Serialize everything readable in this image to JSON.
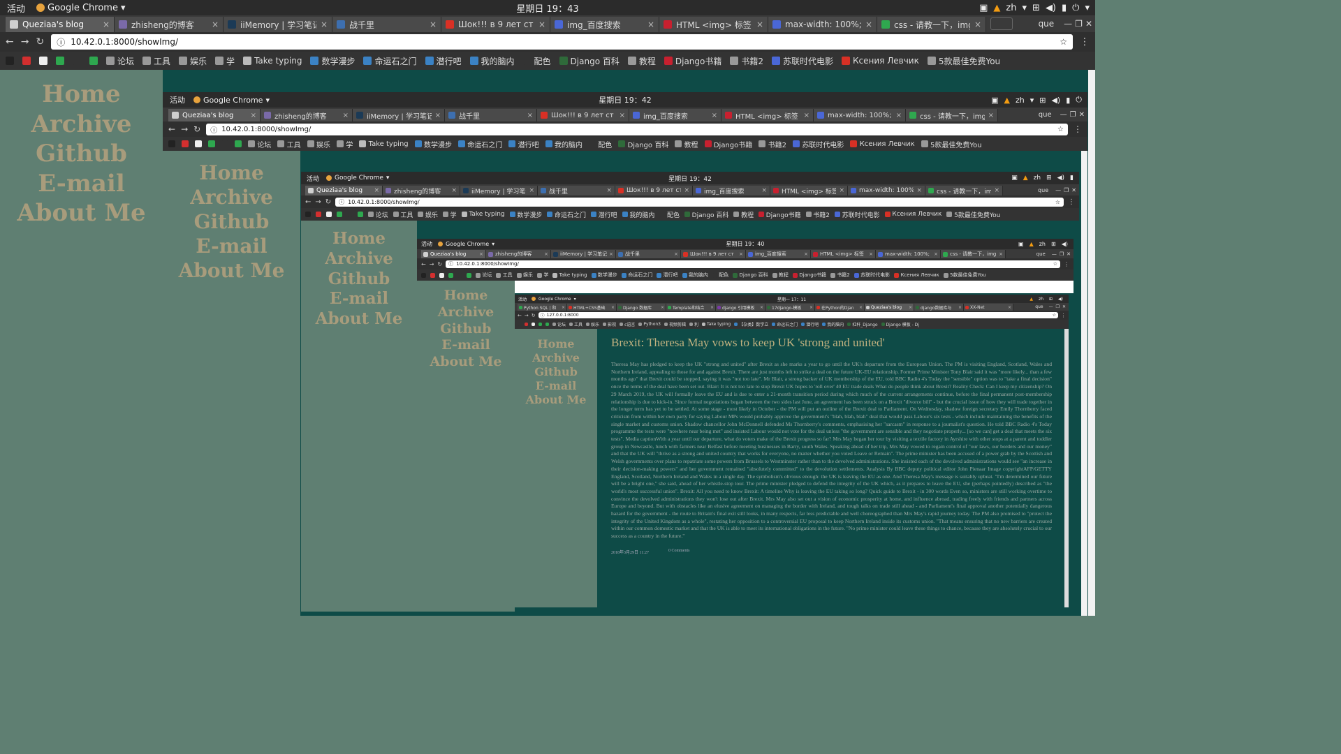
{
  "top": {
    "activities": "活动",
    "app": "Google Chrome",
    "clock": "星期日 19：43",
    "lang": "zh"
  },
  "tabs": [
    {
      "title": "Queziaa's blog",
      "color": "#cfcfcf"
    },
    {
      "title": "zhisheng的博客",
      "color": "#7a6aa8"
    },
    {
      "title": "iiMemory | 学习笔记",
      "color": "#1b3a56"
    },
    {
      "title": "战千里",
      "color": "#3d6fb0"
    },
    {
      "title": "Шок!!! в 9 лет ст",
      "color": "#d93025"
    },
    {
      "title": "img_百度搜索",
      "color": "#4a67d6"
    },
    {
      "title": "HTML <img> 标签",
      "color": "#c8202f"
    },
    {
      "title": "max-width: 100%;",
      "color": "#4a67d6"
    },
    {
      "title": "css - 请教一下，img",
      "color": "#2fa84f"
    }
  ],
  "profile": "que",
  "url": "10.42.0.1:8000/showImg/",
  "bookmarks": [
    {
      "label": "",
      "color": "#222"
    },
    {
      "label": "",
      "color": "#d32f2f"
    },
    {
      "label": "",
      "color": "#eee"
    },
    {
      "label": "",
      "color": "#2ea84f"
    },
    {
      "label": "",
      "color": "#333"
    },
    {
      "label": "",
      "color": "#2ea84f"
    },
    {
      "label": "论坛",
      "color": "#999"
    },
    {
      "label": "工具",
      "color": "#999"
    },
    {
      "label": "娱乐",
      "color": "#999"
    },
    {
      "label": "学",
      "color": "#999"
    },
    {
      "label": "Take typing",
      "color": "#bbb"
    },
    {
      "label": "数学漫步",
      "color": "#3b82c4"
    },
    {
      "label": "命运石之门",
      "color": "#3b82c4"
    },
    {
      "label": "潜行吧",
      "color": "#3b82c4"
    },
    {
      "label": "我的脑内",
      "color": "#3b82c4"
    },
    {
      "label": "配色",
      "color": "#333"
    },
    {
      "label": "Django 百科",
      "color": "#2f6a3a"
    },
    {
      "label": "教程",
      "color": "#999"
    },
    {
      "label": "Django书籍",
      "color": "#c8202f"
    },
    {
      "label": "书籍2",
      "color": "#999"
    },
    {
      "label": "苏联时代电影",
      "color": "#4a67d6"
    },
    {
      "label": "Ксения Левчик",
      "color": "#d93025"
    },
    {
      "label": "5款最佳免费You",
      "color": "#999"
    }
  ],
  "win2": {
    "clock": "星期日 19：42"
  },
  "win3": {
    "clock": "星期日 19：42"
  },
  "win4": {
    "clock": "星期日 19：40"
  },
  "win5": {
    "clock": "星期一 17：11",
    "url": "127.0.0.1:8000",
    "tabs": [
      {
        "title": "Python SQL | 和",
        "color": "#2fa84f"
      },
      {
        "title": "HTML+CSS基础",
        "color": "#d93025"
      },
      {
        "title": "Django 数据库",
        "color": "#2f6a3a"
      },
      {
        "title": "Template和结合",
        "color": "#2fa84f"
      },
      {
        "title": "django 引用模板",
        "color": "#7a3aa8"
      },
      {
        "title": "17django-模板",
        "color": "#2f6a3a"
      },
      {
        "title": "在Python的Djan",
        "color": "#d93025"
      },
      {
        "title": "Queziaa's blog",
        "color": "#cfcfcf"
      },
      {
        "title": "django数据库与",
        "color": "#2f6a3a"
      },
      {
        "title": "XX-Net",
        "color": "#d93025"
      }
    ],
    "bookmarks": [
      {
        "label": "",
        "color": "#333"
      },
      {
        "label": "",
        "color": "#d32f2f"
      },
      {
        "label": "",
        "color": "#eee"
      },
      {
        "label": "",
        "color": "#2ea84f"
      },
      {
        "label": "",
        "color": "#2ea84f"
      },
      {
        "label": "论坛",
        "color": "#999"
      },
      {
        "label": "工具",
        "color": "#999"
      },
      {
        "label": "娱乐",
        "color": "#999"
      },
      {
        "label": "影视",
        "color": "#999"
      },
      {
        "label": "c语言",
        "color": "#999"
      },
      {
        "label": "Python3",
        "color": "#999"
      },
      {
        "label": "视频剪辑",
        "color": "#999"
      },
      {
        "label": "利",
        "color": "#999"
      },
      {
        "label": "Take typing",
        "color": "#bbb"
      },
      {
        "label": "【杂类】数学立",
        "color": "#3b82c4"
      },
      {
        "label": "命运石之门",
        "color": "#3b82c4"
      },
      {
        "label": "潜行吧",
        "color": "#3b82c4"
      },
      {
        "label": "我的脑内",
        "color": "#3b82c4"
      },
      {
        "label": "杠杆_Django",
        "color": "#2f6a3a"
      },
      {
        "label": "Django 模板 - Dj",
        "color": "#2f6a3a"
      }
    ]
  },
  "nav": {
    "home": "Home",
    "archive": "Archive",
    "github": "Github",
    "email": "E-mail",
    "about": "About Me"
  },
  "article": {
    "title": "Brexit: Theresa May vows to keep UK 'strong and united'",
    "body": "Theresa May has pledged to keep the UK \"strong and united\" after Brexit as she marks a year to go until the UK's departure from the European Union. The PM is visiting England, Scotland, Wales and Northern Ireland, appealing to those for and against Brexit. There are just months left to strike a deal on the future UK-EU relationship. Former Prime Minister Tony Blair said it was \"more likely... than a few months ago\" that Brexit could be stopped, saying it was \"not too late\". Mr Blair, a strong backer of UK membership of the EU, told BBC Radio 4's Today the \"sensible\" option was to \"take a final decision\" once the terms of the deal have been set out. Blair: It is not too late to stop Brexit UK hopes to 'roll over' 40 EU trade deals What do people think about Brexit? Reality Check: Can I keep my citizenship? On 29 March 2019, the UK will formally leave the EU and is due to enter a 21-month transition period during which much of the current arrangements continue, before the final permanent post-membership relationship is due to kick-in. Since formal negotiations began between the two sides last June, an agreement has been struck on a Brexit \"divorce bill\" - but the crucial issue of how they will trade together in the longer term has yet to be settled. At some stage - most likely in October - the PM will put an outline of the Brexit deal to Parliament. On Wednesday, shadow foreign secretary Emily Thornberry faced criticism from within her own party for saying Labour MPs would probably approve the government's \"blah, blah, blah\" deal that would pass Labour's six tests - which include maintaining the benefits of the single market and customs union. Shadow chancellor John McDonnell defended Ms Thornberry's comments, emphasising her \"sarcasm\" in response to a journalist's question. He told BBC Radio 4's Today programme the tests were \"nowhere near being met\" and insisted Labour would not vote for the deal unless \"the government are sensible and they negotiate properly... [so we can] get a deal that meets the six tests\". Media captionWith a year until our departure, what do voters make of the Brexit progress so far? Mrs May began her tour by visiting a textile factory in Ayrshire with other stops at a parent and toddler group in Newcastle, lunch with farmers near Belfast before meeting businesses in Barry, south Wales. Speaking ahead of her trip, Mrs May vowed to regain control of \"our laws, our borders and our money\" and that the UK will \"thrive as a strong and united country that works for everyone, no matter whether you voted Leave or Remain\". The prime minister has been accused of a power grab by the Scottish and Welsh governments over plans to repatriate some powers from Brussels to Westminster rather than to the devolved administrations. She insisted each of the devolved administrations would see \"an increase in their decision-making powers\" and her government remained \"absolutely committed\" to the devolution settlements. Analysis By BBC deputy political editor John Pienaar Image copyrightAFP/GETTY England, Scotland, Northern Ireland and Wales in a single day. The symbolism's obvious enough: the UK is leaving the EU as one. And Theresa May's message is suitably upbeat. \"I'm determined our future will be a bright one,\" she said, ahead of her whistle-stop tour. The prime minister pledged to defend the integrity of the UK which, as it prepares to leave the EU, she (perhaps pointedly) described as \"the world's most successful union\". Brexit: All you need to know Brexit: A timeline Why is leaving the EU taking so long? Quick guide to Brexit - in 300 words Even so, ministers are still working overtime to convince the devolved administrations they won't lose out after Brexit. Mrs May also set out a vision of economic prosperity at home, and influence abroad, trading freely with friends and partners across Europe and beyond. But with obstacles like an elusive agreement on managing the border with Ireland, and tough talks on trade still ahead - and Parliament's final approval another potentially dangerous hazard for the government - the route to Britain's final exit still looks, in many respects, far less predictable and well choreographed than Mrs May's rapid journey today. The PM also promised to \"protect the integrity of the United Kingdom as a whole\", restating her opposition to a controversial EU proposal to keep Northern Ireland inside its customs union. \"That means ensuring that no new barriers are created within our common domestic market and that the UK is able to meet its international obligations in the future. \"No prime minister could leave these things to chance, because they are absolutely crucial to our success as a country in the future.\"",
    "date": "2018年3月29日 11:27",
    "comments": "0 Comments"
  }
}
